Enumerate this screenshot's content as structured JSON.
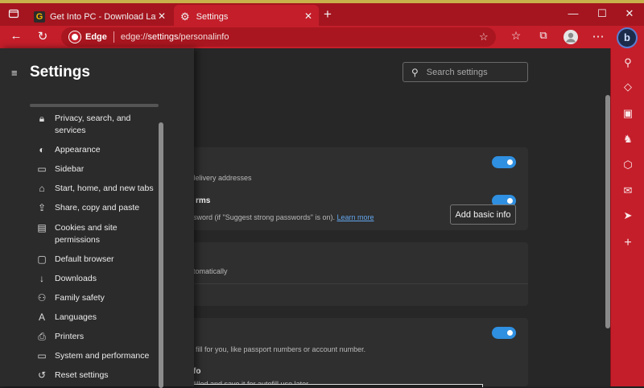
{
  "browser": {
    "tabs": [
      {
        "title": "Get Into PC - Download Latest Software",
        "icon": "g-favicon-icon",
        "active": false
      },
      {
        "title": "Settings",
        "icon": "settings-gear-icon",
        "active": true
      }
    ],
    "new_tab_label": "+",
    "window_controls": {
      "minimize": "—",
      "maximize": "☐",
      "close": "✕"
    },
    "address": {
      "brand": "Edge",
      "url_prefix": "edge://",
      "url_host": "settings",
      "url_path": "/personalinfo"
    },
    "accent_color": "#c41e2a",
    "titlebar_color": "#a4151f"
  },
  "settings_panel": {
    "title": "Settings",
    "items": [
      {
        "label": "Privacy, search, and services",
        "icon": "lock-icon"
      },
      {
        "label": "Appearance",
        "icon": "palette-icon"
      },
      {
        "label": "Sidebar",
        "icon": "sidebar-icon"
      },
      {
        "label": "Start, home, and new tabs",
        "icon": "home-icon"
      },
      {
        "label": "Share, copy and paste",
        "icon": "share-icon"
      },
      {
        "label": "Cookies and site permissions",
        "icon": "cookie-icon"
      },
      {
        "label": "Default browser",
        "icon": "browser-icon"
      },
      {
        "label": "Downloads",
        "icon": "download-icon"
      },
      {
        "label": "Family safety",
        "icon": "family-icon"
      },
      {
        "label": "Languages",
        "icon": "language-icon"
      },
      {
        "label": "Printers",
        "icon": "printer-icon"
      },
      {
        "label": "System and performance",
        "icon": "laptop-icon"
      },
      {
        "label": "Reset settings",
        "icon": "reset-icon"
      }
    ]
  },
  "main": {
    "search_placeholder": "Search settings",
    "card1": {
      "text1": "d delivery addresses",
      "title2": "rms",
      "text2": "sword (if \"Suggest strong passwords\" is on).",
      "link": "Learn more"
    },
    "card2": {
      "text": "tomatically",
      "button": "Add basic info"
    },
    "card3": {
      "text1": "fill for you, like passport numbers or account number.",
      "title2": "fo",
      "text2": "filled and save it for autofill use later."
    },
    "toggle_color": "#2f8fe0"
  }
}
